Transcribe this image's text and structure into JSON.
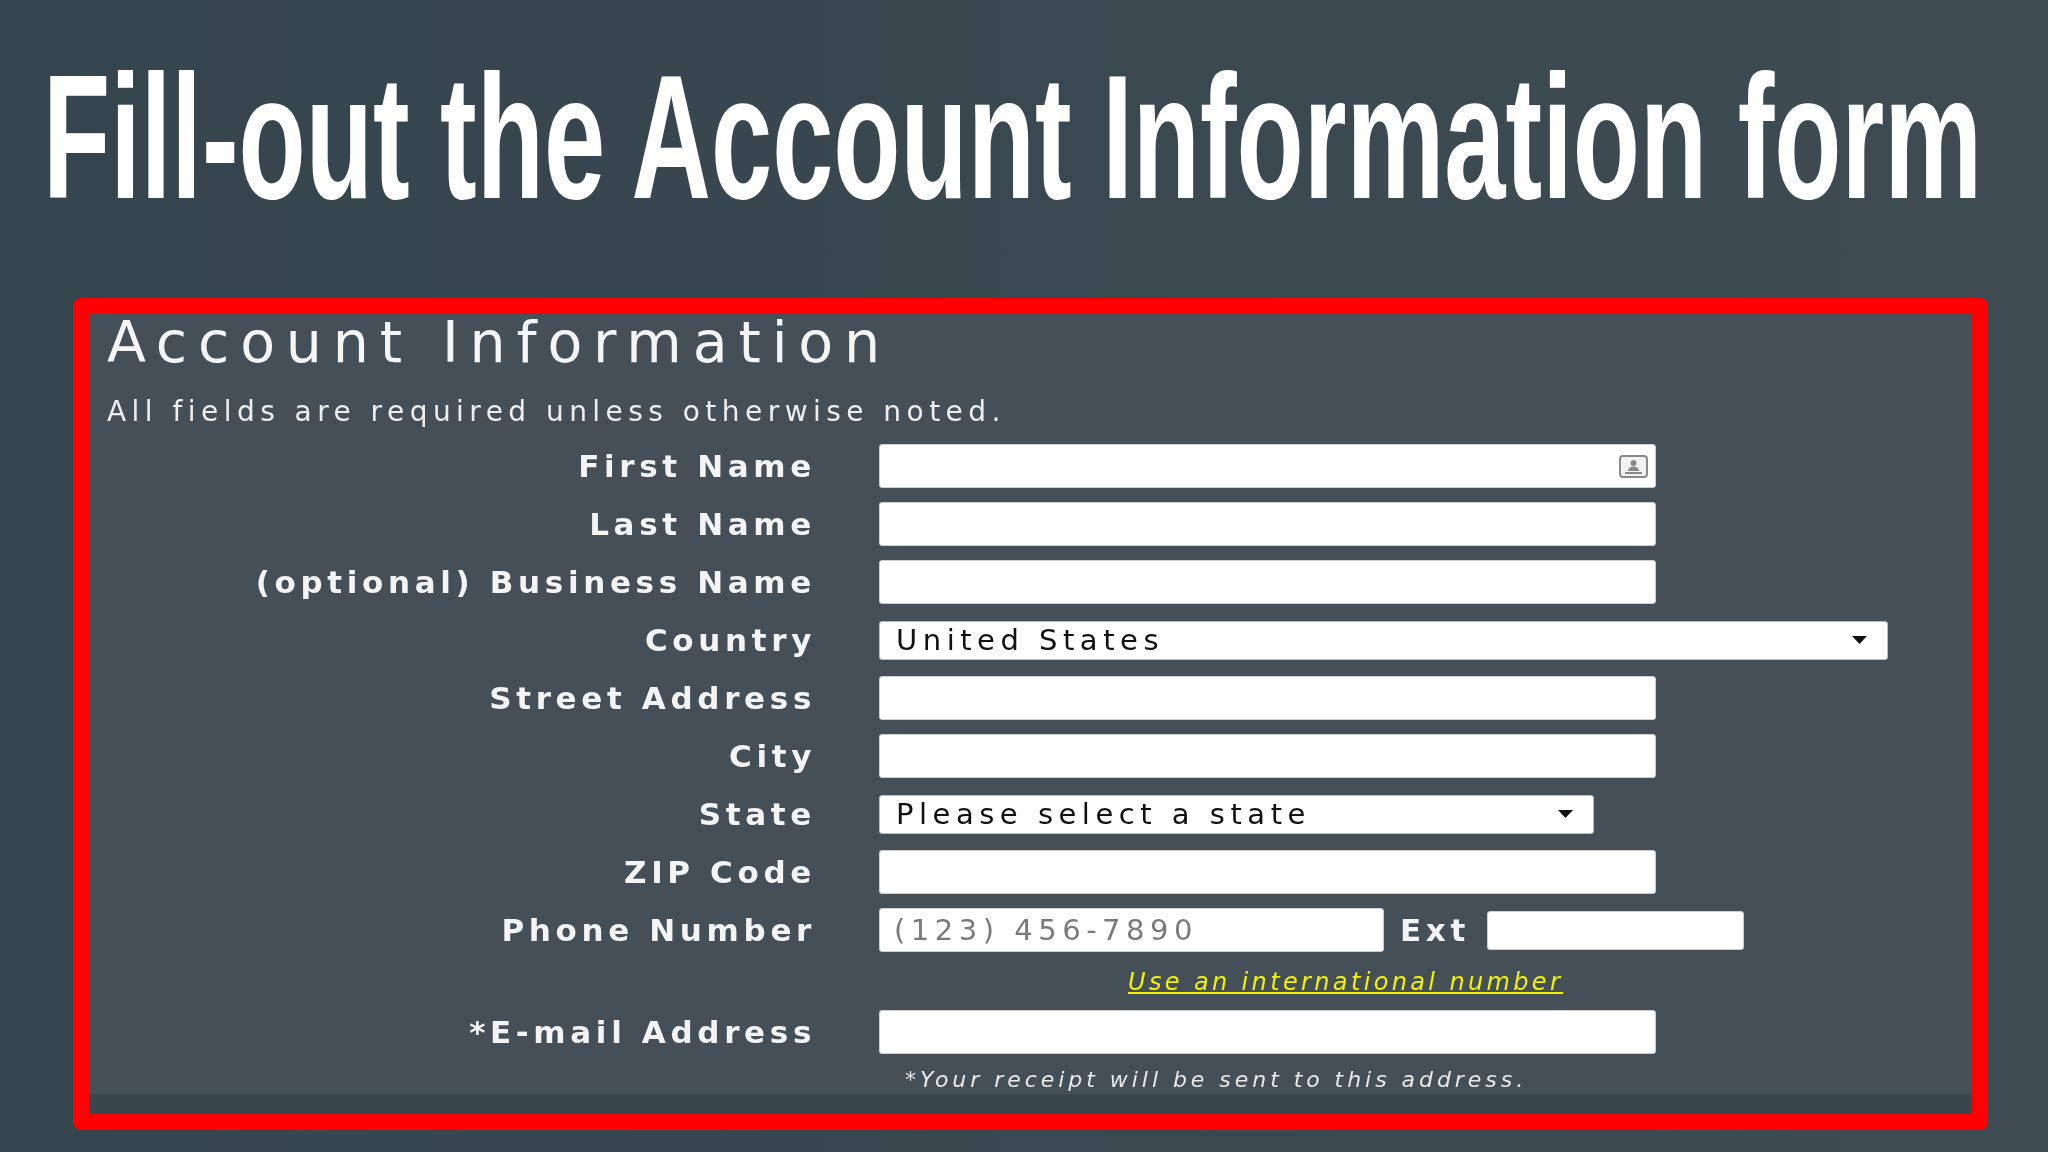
{
  "slide": {
    "title": "Fill-out the Account Information form"
  },
  "form": {
    "heading": "Account Information",
    "note": "All fields are required unless otherwise noted.",
    "fields": [
      {
        "kind": "text",
        "label": "First Name",
        "autofill": true
      },
      {
        "kind": "text",
        "label": "Last Name",
        "autofill": false
      },
      {
        "kind": "text",
        "label": "(optional) Business Name",
        "autofill": false
      },
      {
        "kind": "select",
        "label": "Country",
        "value": "United States"
      },
      {
        "kind": "text",
        "label": "Street Address",
        "autofill": false
      },
      {
        "kind": "text",
        "label": "City",
        "autofill": false
      },
      {
        "kind": "select",
        "label": "State",
        "value": "Please select a state"
      },
      {
        "kind": "text",
        "label": "ZIP Code",
        "autofill": false
      },
      {
        "kind": "phone",
        "label": "Phone Number",
        "placeholder": "(123) 456-7890",
        "ext_label": "Ext",
        "link": "Use an international number"
      },
      {
        "kind": "text",
        "label": "*E-mail Address",
        "autofill": false,
        "hint": "*Your receipt will be sent to this address."
      }
    ]
  }
}
